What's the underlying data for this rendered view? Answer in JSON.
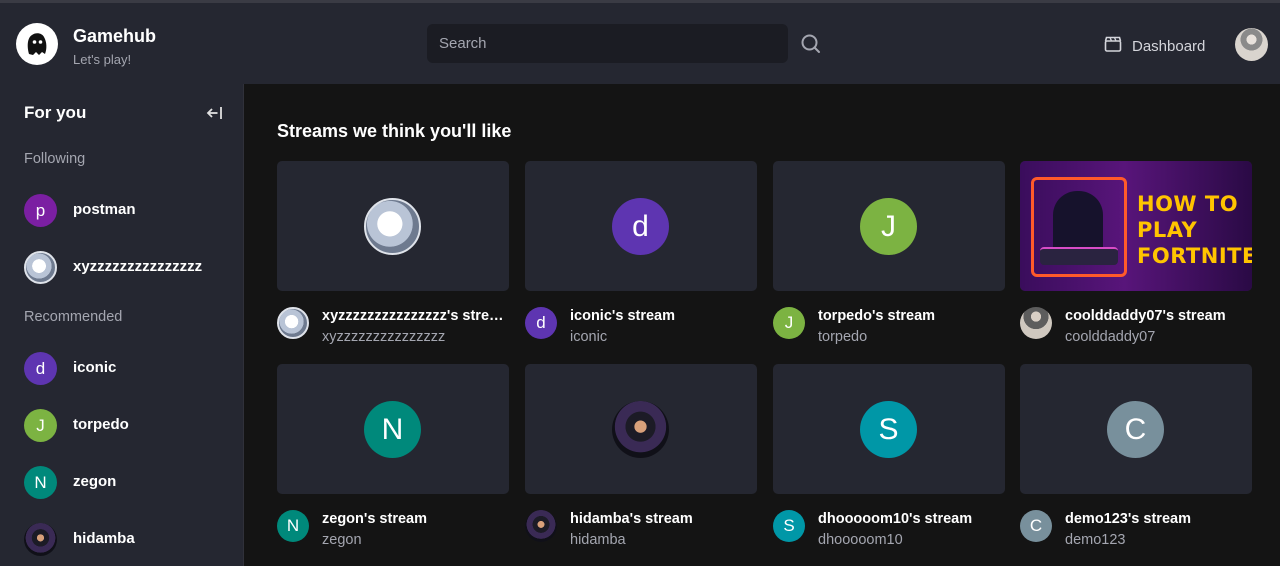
{
  "header": {
    "brand_title": "Gamehub",
    "brand_subtitle": "Let's play!",
    "search_placeholder": "Search",
    "dashboard_label": "Dashboard"
  },
  "sidebar": {
    "title": "For you",
    "following_label": "Following",
    "recommended_label": "Recommended",
    "following": [
      {
        "name": "postman",
        "initial": "p",
        "color": "#7b1fa2"
      },
      {
        "name": "xyzzzzzzzzzzzzzzz",
        "initial": "",
        "color": ""
      }
    ],
    "recommended": [
      {
        "name": "iconic",
        "initial": "d",
        "color": "#5e35b1"
      },
      {
        "name": "torpedo",
        "initial": "J",
        "color": "#7cb342"
      },
      {
        "name": "zegon",
        "initial": "N",
        "color": "#00897b"
      },
      {
        "name": "hidamba",
        "initial": "",
        "color": ""
      }
    ]
  },
  "main": {
    "title": "Streams we think you'll like",
    "streams": [
      {
        "title": "xyzzzzzzzzzzzzzzz's stream",
        "user": "xyzzzzzzzzzzzzzzz",
        "initial": "",
        "color": ""
      },
      {
        "title": "iconic's stream",
        "user": "iconic",
        "initial": "d",
        "color": "#5e35b1"
      },
      {
        "title": "torpedo's stream",
        "user": "torpedo",
        "initial": "J",
        "color": "#7cb342"
      },
      {
        "title": "coolddaddy07's stream",
        "user": "coolddaddy07",
        "initial": "",
        "color": "",
        "thumbnail_text": [
          "HOW TO",
          "PLAY",
          "FORTNITE"
        ]
      },
      {
        "title": "zegon's stream",
        "user": "zegon",
        "initial": "N",
        "color": "#00897b"
      },
      {
        "title": "hidamba's stream",
        "user": "hidamba",
        "initial": "",
        "color": ""
      },
      {
        "title": "dhooooom10's stream",
        "user": "dhooooom10",
        "initial": "S",
        "color": "#0097a7"
      },
      {
        "title": "demo123's stream",
        "user": "demo123",
        "initial": "C",
        "color": "#78909c"
      }
    ]
  }
}
